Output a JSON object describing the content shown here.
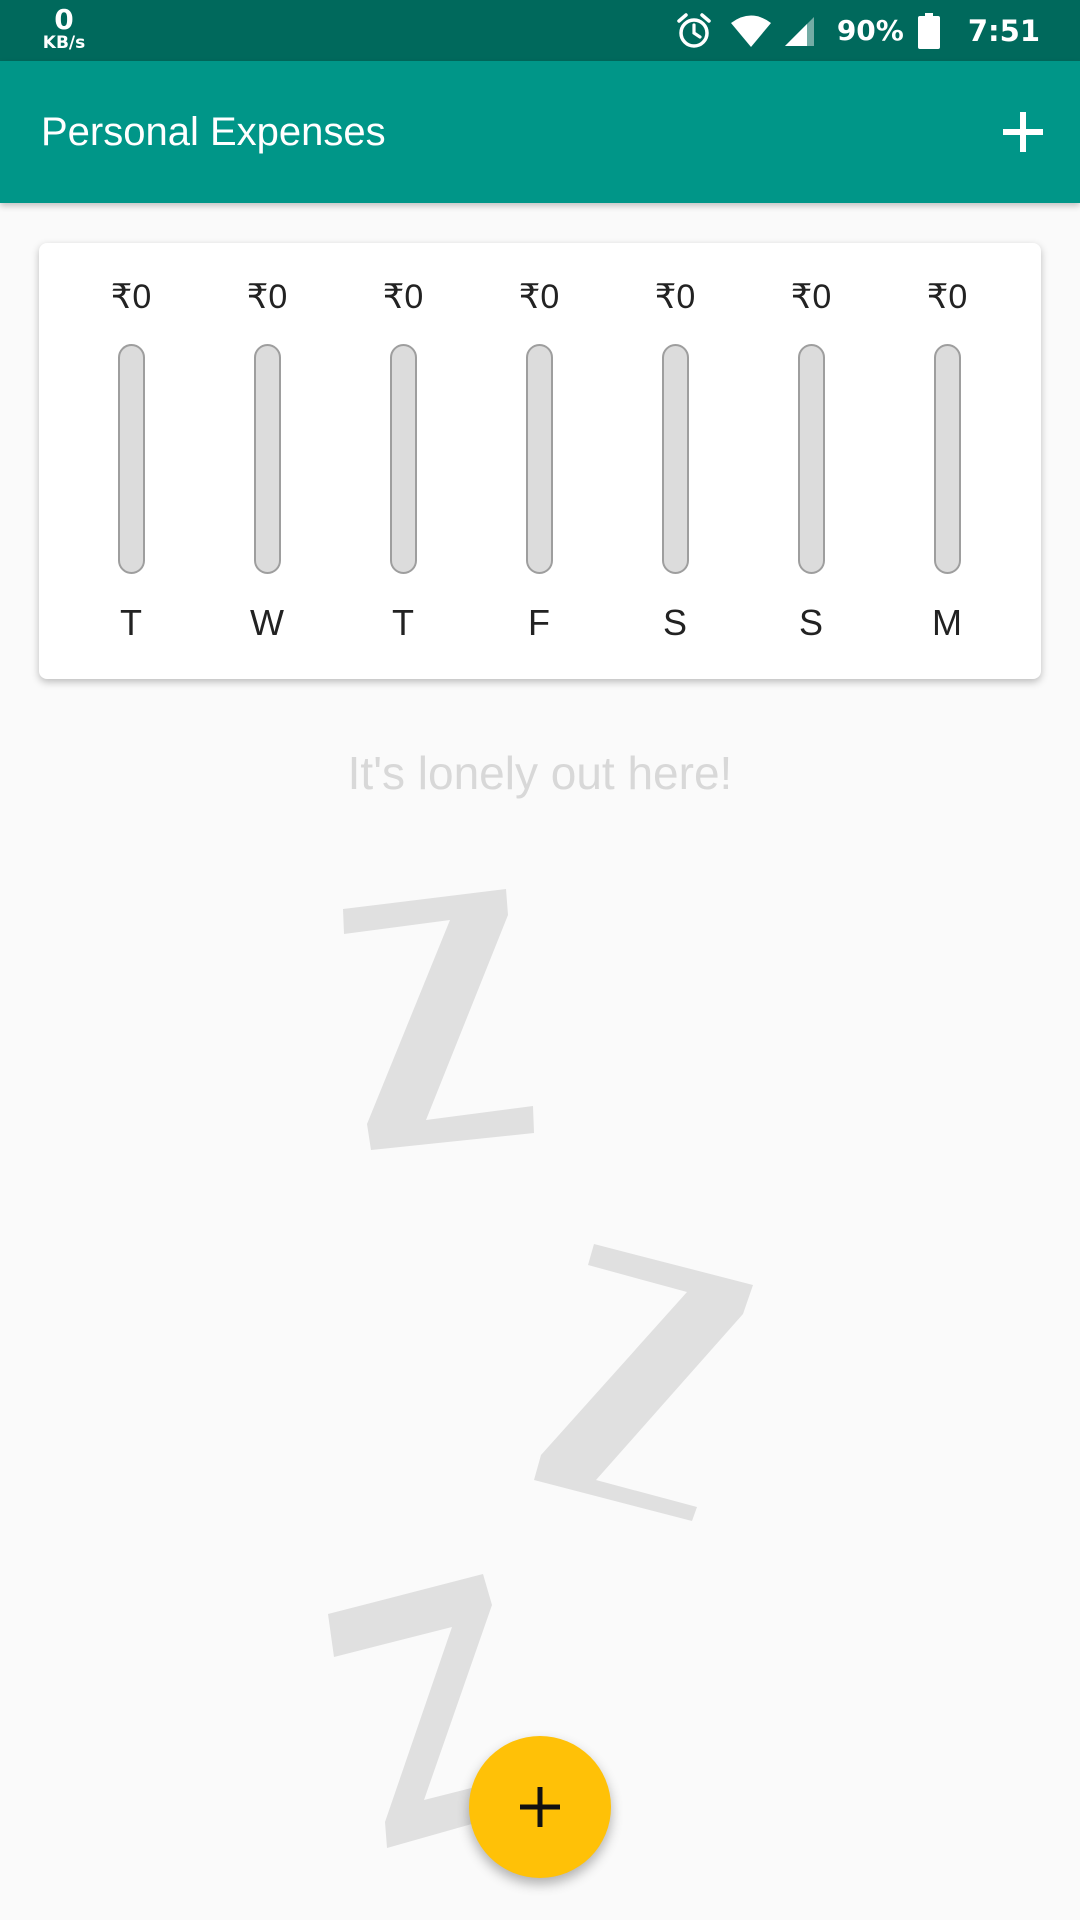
{
  "status_bar": {
    "net_speed": "0",
    "net_unit": "KB/s",
    "battery_percent": "90%",
    "time": "7:51"
  },
  "app_bar": {
    "title": "Personal Expenses",
    "add_icon": "plus-icon"
  },
  "chart": {
    "bars": [
      {
        "day": "T",
        "amount": "₹0",
        "fill": 0
      },
      {
        "day": "W",
        "amount": "₹0",
        "fill": 0
      },
      {
        "day": "T",
        "amount": "₹0",
        "fill": 0
      },
      {
        "day": "F",
        "amount": "₹0",
        "fill": 0
      },
      {
        "day": "S",
        "amount": "₹0",
        "fill": 0
      },
      {
        "day": "S",
        "amount": "₹0",
        "fill": 0
      },
      {
        "day": "M",
        "amount": "₹0",
        "fill": 0
      }
    ]
  },
  "empty_state": {
    "message": "It's lonely out here!",
    "illustration": "sleeping-zzz-icon"
  },
  "fab": {
    "icon": "plus-icon"
  },
  "colors": {
    "primary": "#009688",
    "primary_dark": "#00695c",
    "accent": "#ffc107",
    "background": "#fafafa"
  }
}
